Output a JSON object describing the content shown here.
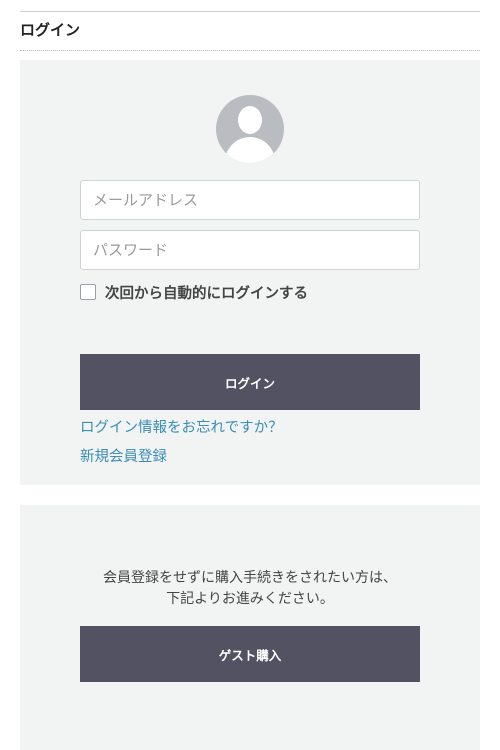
{
  "page_title": "ログイン",
  "login": {
    "email_placeholder": "メールアドレス",
    "password_placeholder": "パスワード",
    "remember_label": "次回から自動的にログインする",
    "login_button": "ログイン",
    "forgot_link": "ログイン情報をお忘れですか？",
    "register_link": "新規会員登録"
  },
  "guest": {
    "text_line1": "会員登録をせずに購入手続きをされたい方は、",
    "text_line2": "下記よりお進みください。",
    "button": "ゲスト購入"
  },
  "colors": {
    "button_bg": "#525263",
    "link": "#3a8eb5",
    "panel_bg": "#f2f3f3"
  }
}
